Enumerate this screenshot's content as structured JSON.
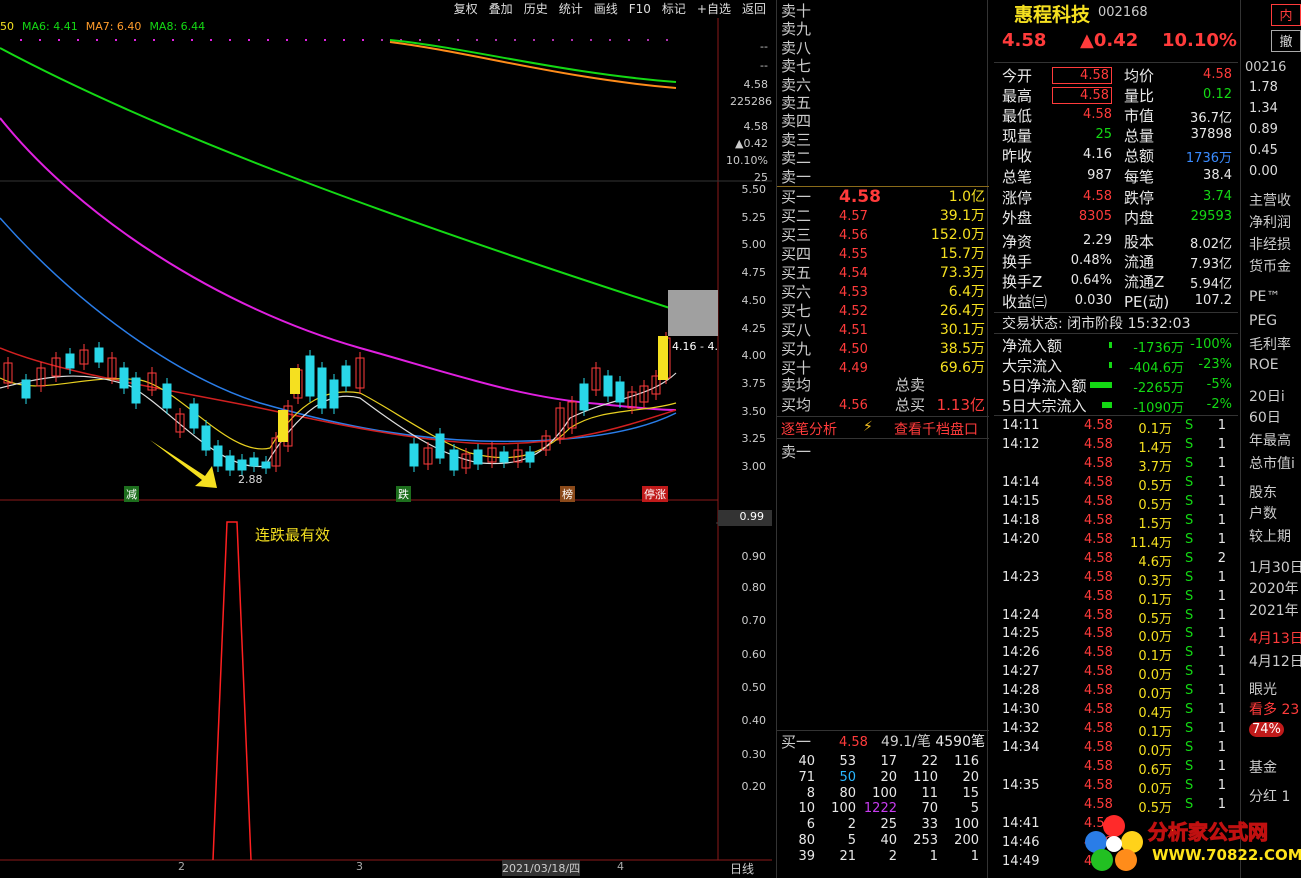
{
  "toolbar": [
    "复权",
    "叠加",
    "历史",
    "统计",
    "画线",
    "F10",
    "标记",
    "+自选",
    "返回"
  ],
  "legend": {
    "ma5": "50",
    "ma6": "MA6: 4.41",
    "ma7": "MA7: 6.40",
    "ma8": "MA8: 6.44"
  },
  "price_axis": [
    "5.50",
    "5.25",
    "5.00",
    "4.75",
    "4.50",
    "4.25",
    "4.00",
    "3.75",
    "3.50",
    "3.25",
    "3.00"
  ],
  "top_axis": {
    "dash1": "--",
    "dash2": "--",
    "price": "4.58",
    "vol": "225286",
    "p2": "4.58",
    "chg": "▲0.42",
    "pct": "10.10%",
    "n": "25"
  },
  "chart_labels": {
    "low": "2.88",
    "box": "4.16 - 4.",
    "bottom": [
      "减",
      "跌",
      "榜",
      "停涨"
    ],
    "signal": "连跌最有效"
  },
  "sub_axis": [
    "0.99",
    "0.90",
    "0.80",
    "0.70",
    "0.60",
    "0.50",
    "0.40",
    "0.30",
    "0.20"
  ],
  "date_axis": {
    "d1": "2",
    "d2": "3",
    "d3": "2021/03/18/四",
    "d4": "4",
    "label": "日线"
  },
  "colors": {
    "up": "#ff3b3b",
    "down": "#29d7e8",
    "ma_green": "#14d914",
    "ma_magenta": "#e020e0",
    "ma_blue": "#2a7de8",
    "ma_red": "#d02020",
    "ma_yellow": "#e8d020",
    "ma_white": "#dddddd",
    "ma_orange": "#ff8c1a"
  },
  "sell_labels": [
    "卖十",
    "卖九",
    "卖八",
    "卖七",
    "卖六",
    "卖五",
    "卖四",
    "卖三",
    "卖二",
    "卖一"
  ],
  "buys": [
    {
      "l": "买一",
      "p": "4.58",
      "v": "1.0亿"
    },
    {
      "l": "买二",
      "p": "4.57",
      "v": "39.1万"
    },
    {
      "l": "买三",
      "p": "4.56",
      "v": "152.0万"
    },
    {
      "l": "买四",
      "p": "4.55",
      "v": "15.7万"
    },
    {
      "l": "买五",
      "p": "4.54",
      "v": "73.3万"
    },
    {
      "l": "买六",
      "p": "4.53",
      "v": "6.4万"
    },
    {
      "l": "买七",
      "p": "4.52",
      "v": "26.4万"
    },
    {
      "l": "买八",
      "p": "4.51",
      "v": "30.1万"
    },
    {
      "l": "买九",
      "p": "4.50",
      "v": "38.5万"
    },
    {
      "l": "买十",
      "p": "4.49",
      "v": "69.6万"
    }
  ],
  "avg": {
    "sell_label": "卖均",
    "sell_total": "总卖",
    "buy_label": "买均",
    "buy_price": "4.56",
    "buy_total_label": "总买",
    "buy_total": "1.13亿"
  },
  "tabs": {
    "t1": "逐笔分析",
    "t2": "查看千档盘口",
    "sell1": "卖一"
  },
  "queue": {
    "label": "买一",
    "price": "4.58",
    "amt": "49.1/笔",
    "cnt": "4590笔",
    "rows": [
      [
        "40",
        "53",
        "17",
        "22",
        "116"
      ],
      [
        "71",
        "50",
        "20",
        "110",
        "20"
      ],
      [
        "8",
        "80",
        "100",
        "11",
        "15"
      ],
      [
        "10",
        "100",
        "1222",
        "70",
        "5"
      ],
      [
        "6",
        "2",
        "25",
        "33",
        "100"
      ],
      [
        "80",
        "5",
        "40",
        "253",
        "200"
      ],
      [
        "39",
        "21",
        "2",
        "1",
        "1"
      ]
    ]
  },
  "stock": {
    "name": "惠程科技",
    "code": "002168",
    "price": "4.58",
    "chg": "▲0.42",
    "pct": "10.10%"
  },
  "stats": [
    {
      "a": "今开",
      "av": "4.58",
      "b": "均价",
      "bv": "4.58"
    },
    {
      "a": "最高",
      "av": "4.58",
      "b": "量比",
      "bv": "0.12"
    },
    {
      "a": "最低",
      "av": "4.58",
      "b": "市值",
      "bv": "36.7亿"
    },
    {
      "a": "现量",
      "av": "25",
      "b": "总量",
      "bv": "37898"
    },
    {
      "a": "昨收",
      "av": "4.16",
      "b": "总额",
      "bv": "1736万"
    },
    {
      "a": "总笔",
      "av": "987",
      "b": "每笔",
      "bv": "38.4"
    },
    {
      "a": "涨停",
      "av": "4.58",
      "b": "跌停",
      "bv": "3.74"
    },
    {
      "a": "外盘",
      "av": "8305",
      "b": "内盘",
      "bv": "29593"
    },
    {
      "a": "净资",
      "av": "2.29",
      "b": "股本",
      "bv": "8.02亿"
    },
    {
      "a": "换手",
      "av": "0.48%",
      "b": "流通",
      "bv": "7.93亿"
    },
    {
      "a": "换手Z",
      "av": "0.64%",
      "b": "流通Z",
      "bv": "5.94亿"
    },
    {
      "a": "收益㈢",
      "av": "0.030",
      "b": "PE(动)",
      "bv": "107.2"
    }
  ],
  "status": "交易状态: 闭市阶段 15:32:03",
  "flows": [
    {
      "l": "净流入额",
      "v": "-1736万",
      "p": "-100%"
    },
    {
      "l": "大宗流入",
      "v": "-404.6万",
      "p": "-23%"
    },
    {
      "l": "5日净流入额",
      "v": "-2265万",
      "p": "-5%"
    },
    {
      "l": "5日大宗流入",
      "v": "-1090万",
      "p": "-2%"
    }
  ],
  "ticks": [
    {
      "t": "14:11",
      "p": "4.58",
      "v": "0.1万",
      "s": "S",
      "n": "1"
    },
    {
      "t": "14:12",
      "p": "4.58",
      "v": "1.4万",
      "s": "S",
      "n": "1"
    },
    {
      "t": "",
      "p": "4.58",
      "v": "3.7万",
      "s": "S",
      "n": "1"
    },
    {
      "t": "14:14",
      "p": "4.58",
      "v": "0.5万",
      "s": "S",
      "n": "1"
    },
    {
      "t": "14:15",
      "p": "4.58",
      "v": "0.5万",
      "s": "S",
      "n": "1"
    },
    {
      "t": "14:18",
      "p": "4.58",
      "v": "1.5万",
      "s": "S",
      "n": "1"
    },
    {
      "t": "14:20",
      "p": "4.58",
      "v": "11.4万",
      "s": "S",
      "n": "1"
    },
    {
      "t": "",
      "p": "4.58",
      "v": "4.6万",
      "s": "S",
      "n": "2"
    },
    {
      "t": "14:23",
      "p": "4.58",
      "v": "0.3万",
      "s": "S",
      "n": "1"
    },
    {
      "t": "",
      "p": "4.58",
      "v": "0.1万",
      "s": "S",
      "n": "1"
    },
    {
      "t": "14:24",
      "p": "4.58",
      "v": "0.5万",
      "s": "S",
      "n": "1"
    },
    {
      "t": "14:25",
      "p": "4.58",
      "v": "0.0万",
      "s": "S",
      "n": "1"
    },
    {
      "t": "14:26",
      "p": "4.58",
      "v": "0.1万",
      "s": "S",
      "n": "1"
    },
    {
      "t": "14:27",
      "p": "4.58",
      "v": "0.0万",
      "s": "S",
      "n": "1"
    },
    {
      "t": "14:28",
      "p": "4.58",
      "v": "0.0万",
      "s": "S",
      "n": "1"
    },
    {
      "t": "14:30",
      "p": "4.58",
      "v": "0.4万",
      "s": "S",
      "n": "1"
    },
    {
      "t": "14:32",
      "p": "4.58",
      "v": "0.1万",
      "s": "S",
      "n": "1"
    },
    {
      "t": "14:34",
      "p": "4.58",
      "v": "0.0万",
      "s": "S",
      "n": "1"
    },
    {
      "t": "",
      "p": "4.58",
      "v": "0.6万",
      "s": "S",
      "n": "1"
    },
    {
      "t": "14:35",
      "p": "4.58",
      "v": "0.0万",
      "s": "S",
      "n": "1"
    },
    {
      "t": "",
      "p": "4.58",
      "v": "0.5万",
      "s": "S",
      "n": "1"
    },
    {
      "t": "14:41",
      "p": "4.58",
      "v": "",
      "s": "",
      "n": ""
    },
    {
      "t": "14:46",
      "p": "4.58",
      "v": "",
      "s": "",
      "n": ""
    },
    {
      "t": "14:49",
      "p": "4.58",
      "v": "",
      "s": "",
      "n": ""
    }
  ],
  "right": {
    "btn1": "内",
    "btn2": "撤",
    "code": "00216",
    "vals": [
      "1.78",
      "1.34",
      "0.89",
      "0.45",
      "0.00"
    ],
    "items": [
      "主营收",
      "净利润",
      "非经损",
      "货币金",
      "PE™",
      "PEG",
      "毛利率",
      "ROE",
      "20日i",
      "60日",
      "年最高",
      "总市值i",
      "股东",
      "户数",
      "较上期",
      "1月30日",
      "2020年",
      "2021年",
      "4月13日",
      "4月12日",
      "眼光",
      "看多 23",
      "74%",
      "基金",
      "分红 1"
    ]
  },
  "logo": {
    "title": "分析家公式网",
    "url": "WWW.70822.COM"
  }
}
